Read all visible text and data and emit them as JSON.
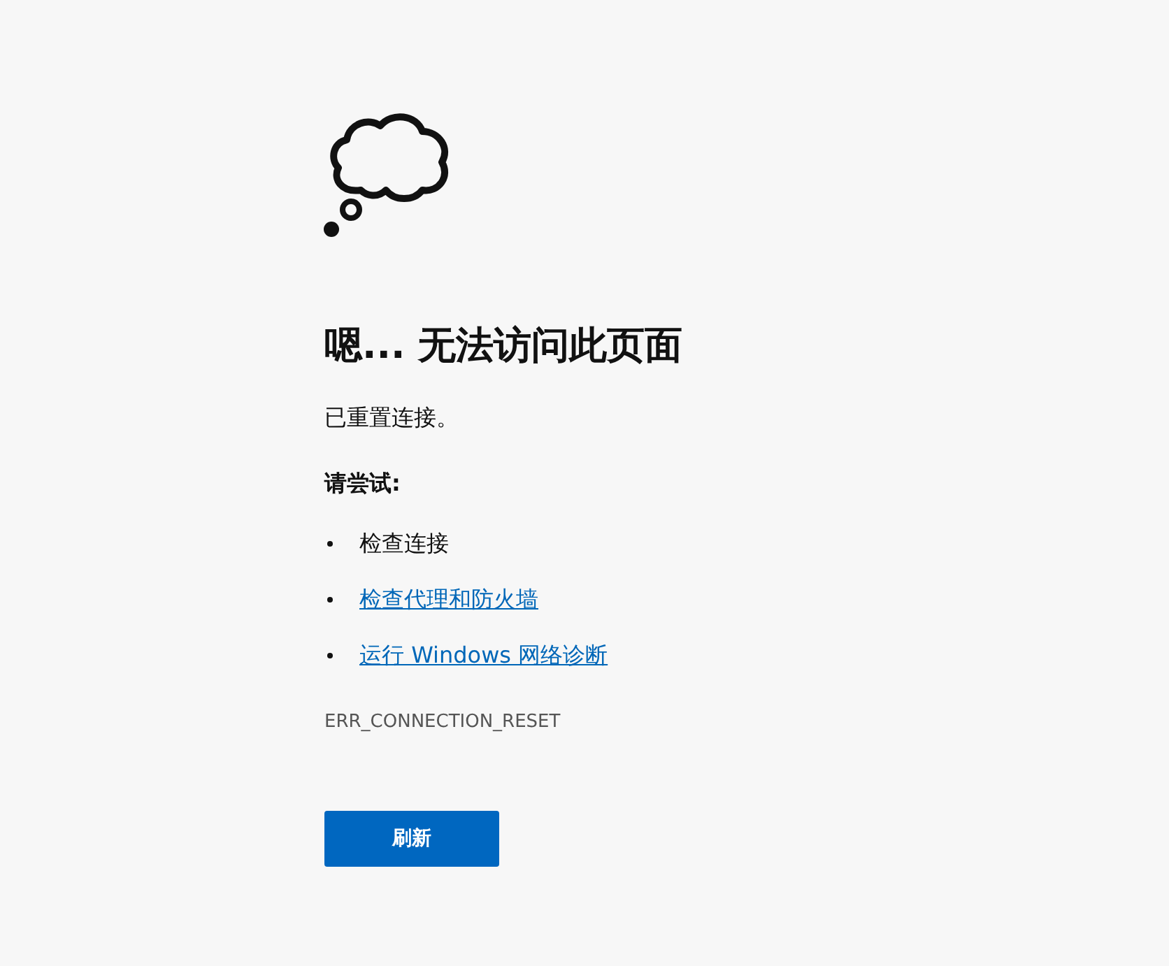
{
  "heading": "嗯... 无法访问此页面",
  "message": "已重置连接。",
  "suggestions_title": "请尝试:",
  "suggestions": [
    {
      "text": "检查连接",
      "kind": "text"
    },
    {
      "text": "检查代理和防火墙",
      "kind": "link"
    },
    {
      "text": "运行 Windows 网络诊断",
      "kind": "link"
    }
  ],
  "error_code": "ERR_CONNECTION_RESET",
  "button": "刷新"
}
